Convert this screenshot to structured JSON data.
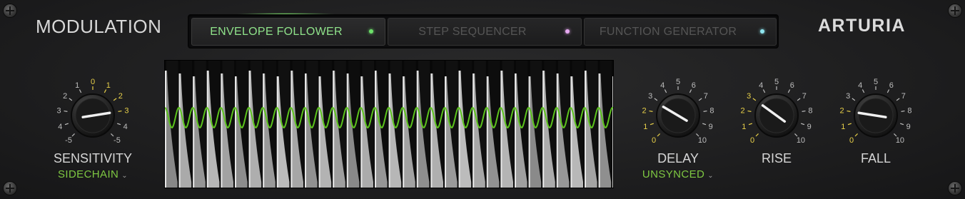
{
  "header": {
    "section_title": "MODULATION",
    "brand": "ARTURIA"
  },
  "tabs": [
    {
      "label": "ENVELOPE FOLLOWER",
      "active": true,
      "dot_color": "#6de06a"
    },
    {
      "label": "STEP SEQUENCER",
      "active": false,
      "dot_color": "#e6a8f0"
    },
    {
      "label": "FUNCTION GENERATOR",
      "active": false,
      "dot_color": "#8fe6f0"
    }
  ],
  "colors": {
    "accent_green": "#7ec842",
    "scale_yellow": "#e8d04a",
    "waveform_gray": "#a8a8a8",
    "envelope_green": "#5cc41c"
  },
  "knobs": {
    "sensitivity": {
      "label": "SENSITIVITY",
      "mode_value": "SIDECHAIN",
      "scale": [
        "-5",
        "4",
        "3",
        "2",
        "1",
        "0",
        "1",
        "2",
        "3",
        "4",
        "-5"
      ],
      "value": 0.8
    },
    "delay": {
      "label": "DELAY",
      "mode_value": "UNSYNCED",
      "scale": [
        "0",
        "1",
        "2",
        "3",
        "4",
        "5",
        "6",
        "7",
        "8",
        "9",
        "10"
      ],
      "value": 0.28
    },
    "rise": {
      "label": "RISE",
      "scale": [
        "0",
        "1",
        "2",
        "3",
        "4",
        "5",
        "6",
        "7",
        "8",
        "9",
        "10"
      ],
      "value": 0.3
    },
    "fall": {
      "label": "FALL",
      "scale": [
        "0",
        "1",
        "2",
        "3",
        "4",
        "5",
        "6",
        "7",
        "8",
        "9",
        "10"
      ],
      "value": 0.2
    }
  },
  "icons": {
    "dropdown": "chevron-down-icon",
    "screw": "screw-icon"
  }
}
